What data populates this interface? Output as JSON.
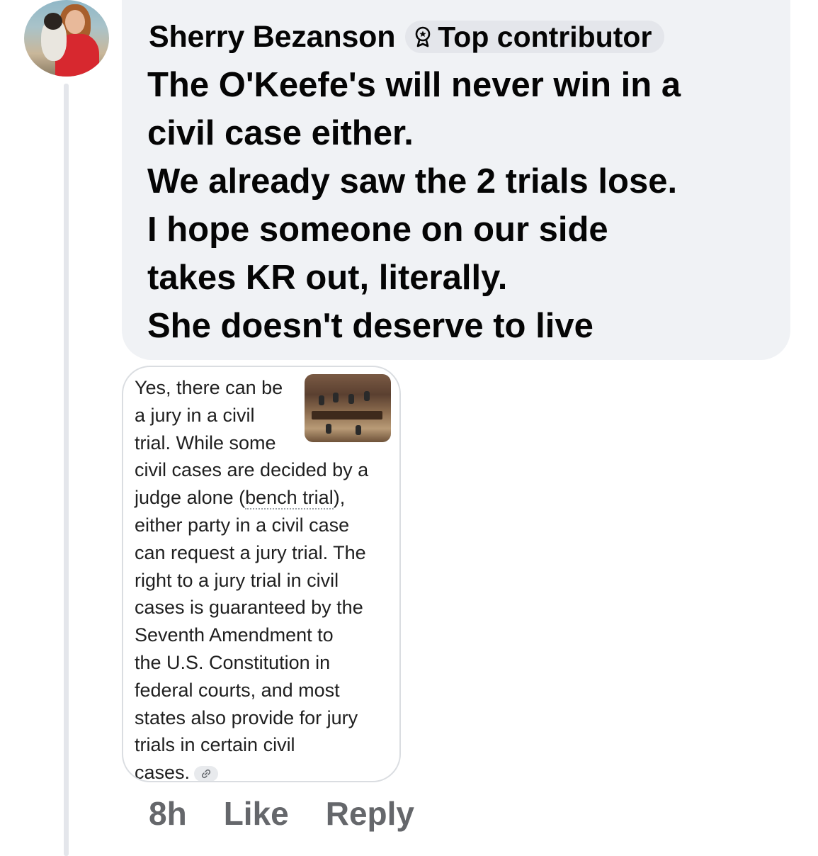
{
  "comment": {
    "author": "Sherry Bezanson",
    "badge_label": "Top contributor",
    "text_lines": [
      "The O'Keefe's will never win in a",
      "civil case either.",
      "We already saw the 2 trials lose.",
      "I hope someone on our side",
      "takes KR out, literally.",
      "She doesn't deserve to live"
    ],
    "badge_icon": "award-icon"
  },
  "attachment": {
    "text_lines": [
      "Yes, there can be",
      "a jury in a civil",
      "trial. While some",
      "civil cases are decided by a",
      "judge alone (",
      "bench trial",
      "),",
      "either party in a civil case",
      "can request a jury trial. The",
      "right to a jury trial in civil",
      "cases is guaranteed by the",
      "Seventh Amendment to",
      "the U.S. Constitution in",
      "federal courts, and most",
      "states also provide for jury",
      "trials in certain civil",
      "cases."
    ],
    "thumbnail": "courtroom-thumbnail",
    "link_icon": "link-icon"
  },
  "actions": {
    "time": "8h",
    "like": "Like",
    "reply": "Reply"
  }
}
